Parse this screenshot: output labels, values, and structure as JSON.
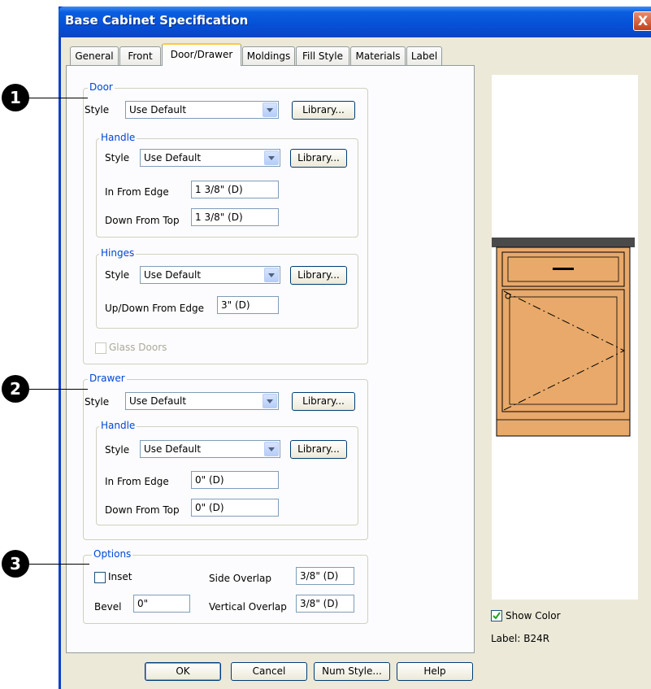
{
  "window": {
    "title": "Base Cabinet Specification",
    "close_glyph": "X"
  },
  "tabs": [
    "General",
    "Front",
    "Door/Drawer",
    "Moldings",
    "Fill Style",
    "Materials",
    "Label"
  ],
  "callouts": [
    "1",
    "2",
    "3"
  ],
  "door": {
    "group_label": "Door",
    "style_label": "Style",
    "style_value": "Use Default",
    "library_label": "Library...",
    "handle": {
      "group_label": "Handle",
      "style_label": "Style",
      "style_value": "Use Default",
      "library_label": "Library...",
      "in_from_edge_label": "In From Edge",
      "in_from_edge_value": "1 3/8\" (D)",
      "down_from_top_label": "Down From Top",
      "down_from_top_value": "1 3/8\" (D)"
    },
    "hinges": {
      "group_label": "Hinges",
      "style_label": "Style",
      "style_value": "Use Default",
      "library_label": "Library...",
      "updown_label": "Up/Down From Edge",
      "updown_value": "3\" (D)"
    },
    "glass_doors_label": "Glass Doors"
  },
  "drawer": {
    "group_label": "Drawer",
    "style_label": "Style",
    "style_value": "Use Default",
    "library_label": "Library...",
    "handle": {
      "group_label": "Handle",
      "style_label": "Style",
      "style_value": "Use Default",
      "library_label": "Library...",
      "in_from_edge_label": "In From Edge",
      "in_from_edge_value": "0\" (D)",
      "down_from_top_label": "Down From Top",
      "down_from_top_value": "0\" (D)"
    }
  },
  "options": {
    "group_label": "Options",
    "inset_label": "Inset",
    "side_overlap_label": "Side Overlap",
    "side_overlap_value": "3/8\" (D)",
    "bevel_label": "Bevel",
    "bevel_value": "0\"",
    "vertical_overlap_label": "Vertical Overlap",
    "vertical_overlap_value": "3/8\" (D)"
  },
  "preview": {
    "show_color_label": "Show Color",
    "label_text": "Label:  B24R",
    "colors": {
      "countertop": "#4a4a4a",
      "wood": "#e8a96a",
      "line": "#000000"
    }
  },
  "buttons": {
    "ok": "OK",
    "cancel": "Cancel",
    "num_style": "Num Style...",
    "help": "Help"
  }
}
